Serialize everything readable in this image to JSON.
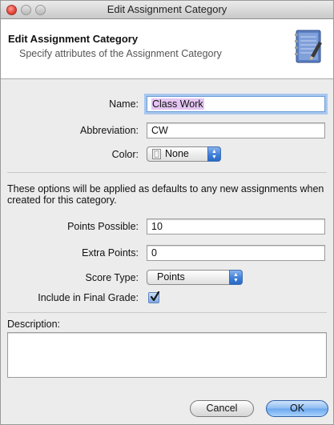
{
  "window": {
    "title": "Edit Assignment Category"
  },
  "header": {
    "title": "Edit Assignment Category",
    "subtitle": "Specify attributes of the Assignment Category",
    "icon": "notebook-pencil-icon"
  },
  "form": {
    "name": {
      "label": "Name:",
      "value": "Class Work"
    },
    "abbreviation": {
      "label": "Abbreviation:",
      "value": "CW"
    },
    "color": {
      "label": "Color:",
      "value": "None"
    },
    "defaults_note": "These options will be applied as defaults to any new assignments when created for this category.",
    "points_possible": {
      "label": "Points Possible:",
      "value": "10"
    },
    "extra_points": {
      "label": "Extra Points:",
      "value": "0"
    },
    "score_type": {
      "label": "Score Type:",
      "value": "Points"
    },
    "include_final": {
      "label": "Include in Final Grade:",
      "checked": true
    },
    "description": {
      "label": "Description:",
      "value": ""
    }
  },
  "buttons": {
    "cancel": "Cancel",
    "ok": "OK"
  },
  "colors": {
    "accent": "#3f7fd9",
    "focus_ring": "#a7c7ee",
    "selection": "#e4c6f2"
  }
}
